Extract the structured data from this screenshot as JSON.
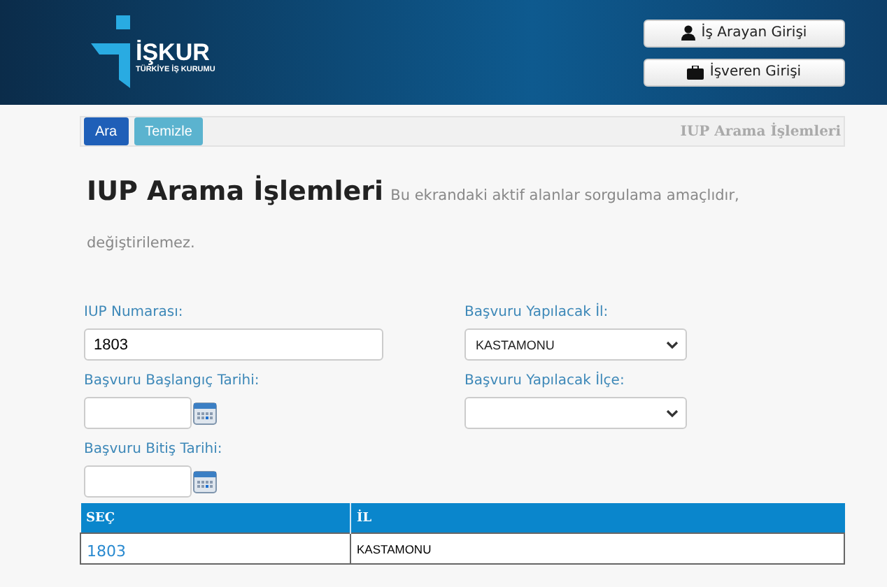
{
  "header": {
    "logo_name": "İŞKUR",
    "logo_subtitle": "TÜRKİYE İŞ KURUMU",
    "buttons": [
      {
        "label": "İş Arayan Girişi",
        "kind": "job-seeker"
      },
      {
        "label": "İşveren Girişi",
        "kind": "employer"
      }
    ]
  },
  "toolbar": {
    "buttons": [
      {
        "label": "Ara",
        "kind": "primary"
      },
      {
        "label": "Temizle",
        "kind": "info"
      }
    ],
    "title": "IUP Arama İşlemleri"
  },
  "page": {
    "title": "IUP Arama İşlemleri",
    "subtitle": "Bu ekrandaki aktif alanlar sorgulama amaçlıdır, değiştirilemez."
  },
  "form": {
    "left": [
      {
        "label": "IUP Numarası:",
        "kind": "text",
        "value": "1803"
      },
      {
        "label": "Başvuru Başlangıç Tarihi:",
        "kind": "date"
      },
      {
        "label": "Başvuru Bitiş Tarihi:",
        "kind": "date"
      }
    ],
    "right": [
      {
        "label": "Başvuru Yapılacak İl:",
        "kind": "select",
        "value": "KASTAMONU"
      },
      {
        "label": "Başvuru Yapılacak İlçe:",
        "kind": "select"
      }
    ]
  },
  "table": {
    "columns": [
      "SEÇ",
      "İL"
    ],
    "rows": [
      [
        "1803",
        "KASTAMONU"
      ]
    ]
  }
}
